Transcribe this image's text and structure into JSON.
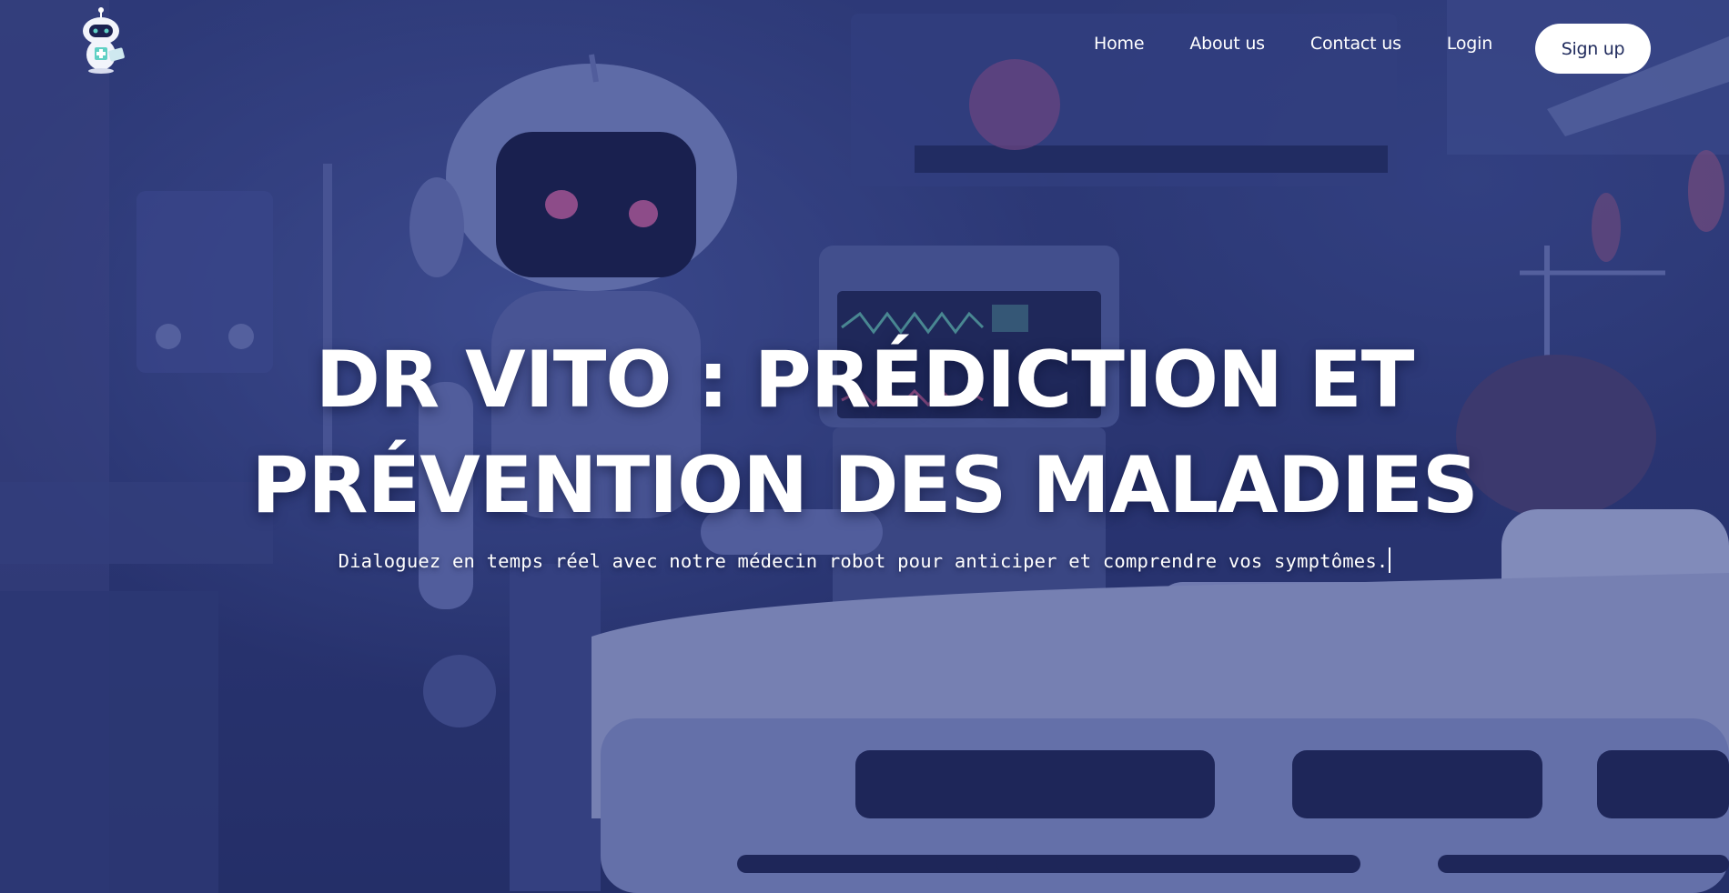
{
  "brand": {
    "logo_icon": "robot-doctor-logo",
    "accent_color": "#ffffff",
    "background_tint": "#2b3570"
  },
  "nav": {
    "items": [
      {
        "label": "Home"
      },
      {
        "label": "About us"
      },
      {
        "label": "Contact us"
      },
      {
        "label": "Login"
      }
    ],
    "signup_label": "Sign up"
  },
  "hero": {
    "title_line_1": "DR VITO : PRÉDICTION ET",
    "title_line_2": "PRÉVENTION DES MALADIES",
    "subtitle": "Dialoguez en temps réel avec notre médecin robot pour anticiper et comprendre vos symptômes.",
    "background_image": "robot-doctor-hospital-scene"
  }
}
